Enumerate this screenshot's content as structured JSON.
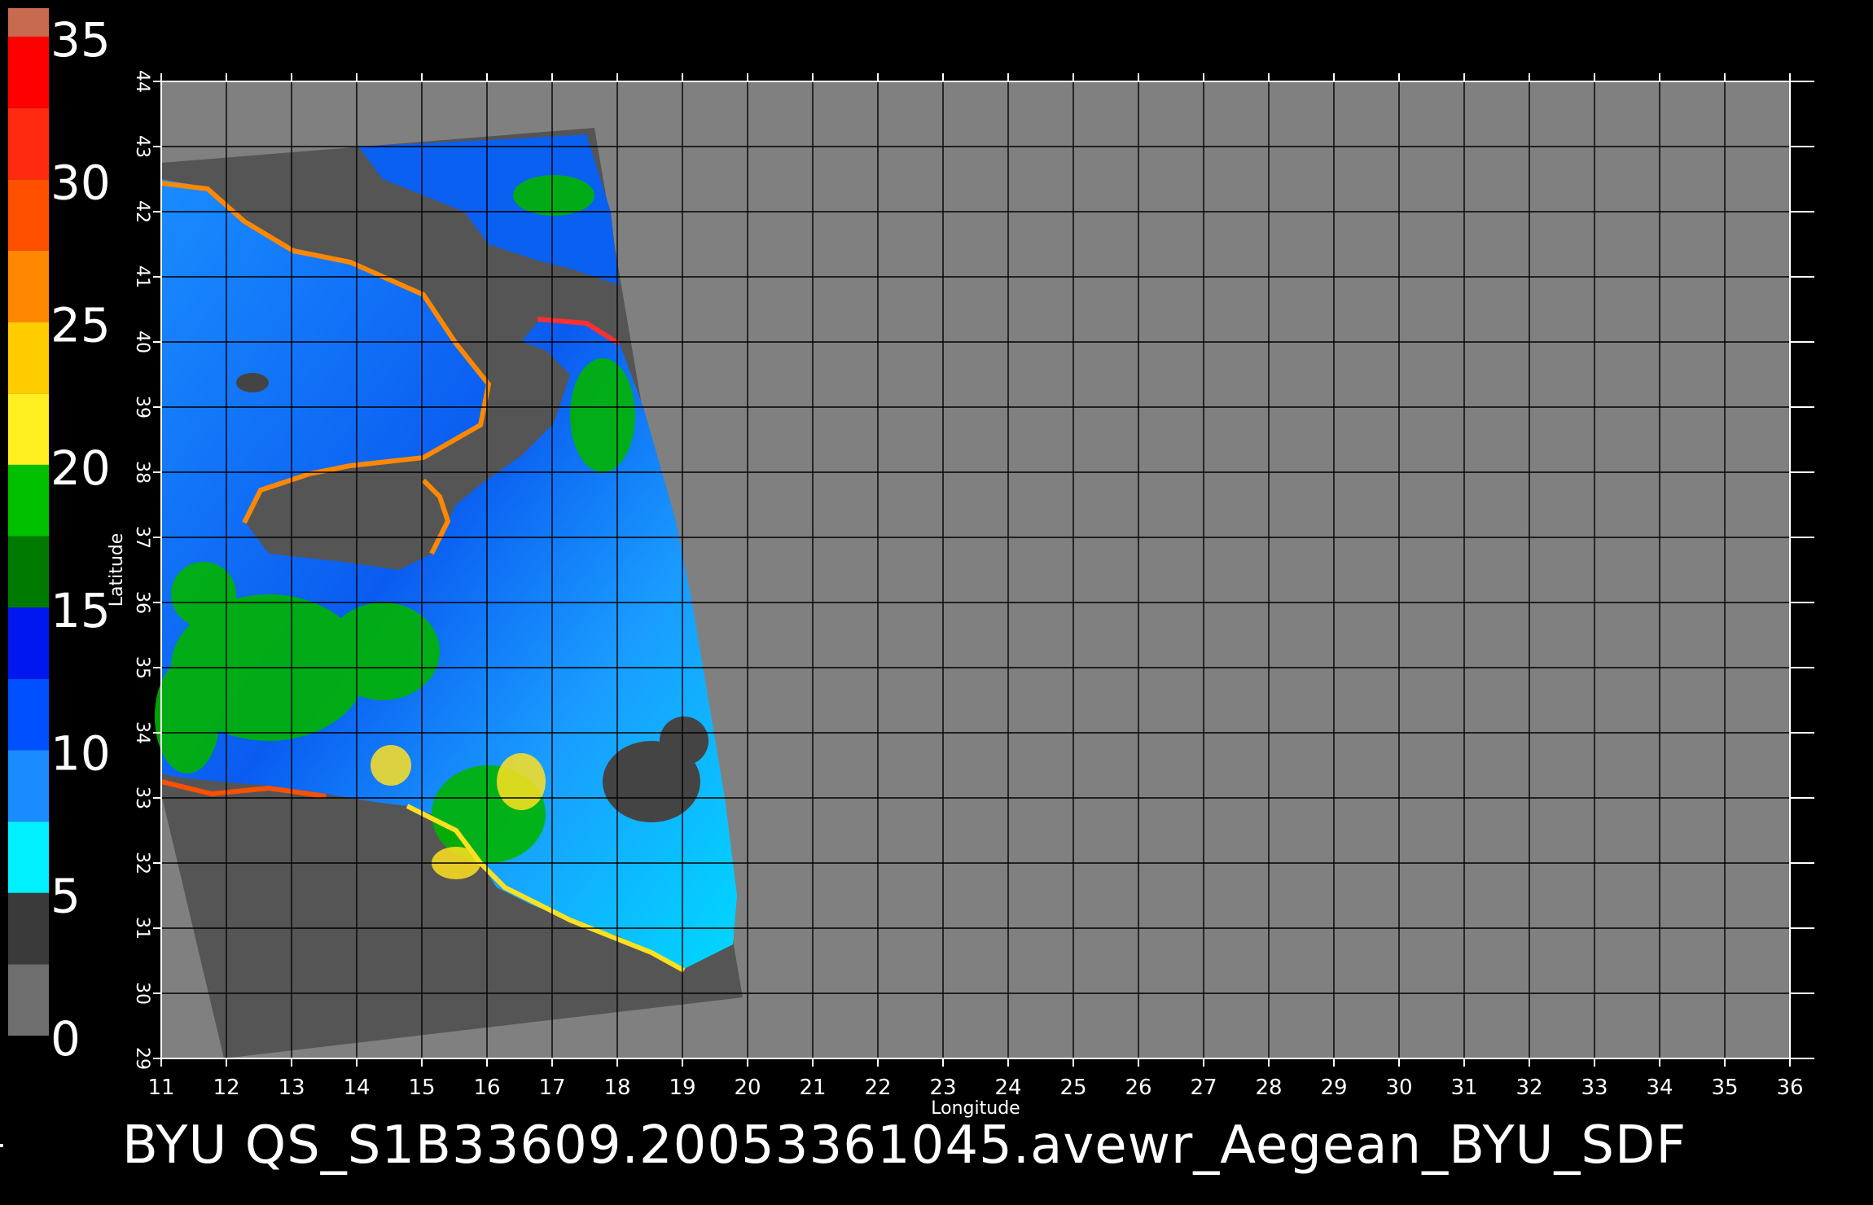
{
  "figure": {
    "title": "BYU  QS_S1B33609.20053361045.avewr_Aegean_BYU_SDF",
    "xlabel": "Longitude",
    "ylabel": "Latitude"
  },
  "colorbar": {
    "tick_labels": [
      "35",
      "30",
      "25",
      "20",
      "15",
      "10",
      "5",
      "0"
    ],
    "stops": [
      {
        "from": 0,
        "to": 2.5,
        "color": "#6e6e6e"
      },
      {
        "from": 2.5,
        "to": 5,
        "color": "#3a3a3a"
      },
      {
        "from": 5,
        "to": 7.5,
        "color": "#00f0ff"
      },
      {
        "from": 7.5,
        "to": 10,
        "color": "#1a8cff"
      },
      {
        "from": 10,
        "to": 12.5,
        "color": "#0050ff"
      },
      {
        "from": 12.5,
        "to": 15,
        "color": "#0018f0"
      },
      {
        "from": 15,
        "to": 17.5,
        "color": "#007a00"
      },
      {
        "from": 17.5,
        "to": 20,
        "color": "#00c000"
      },
      {
        "from": 20,
        "to": 22.5,
        "color": "#ffee20"
      },
      {
        "from": 22.5,
        "to": 25,
        "color": "#ffcc00"
      },
      {
        "from": 25,
        "to": 27.5,
        "color": "#ff8800"
      },
      {
        "from": 27.5,
        "to": 30,
        "color": "#ff5000"
      },
      {
        "from": 30,
        "to": 32.5,
        "color": "#ff2a10"
      },
      {
        "from": 32.5,
        "to": 35,
        "color": "#ff0000"
      },
      {
        "from": 35,
        "to": 36,
        "color": "#c86a50"
      }
    ]
  },
  "map": {
    "xlim": [
      11,
      36
    ],
    "ylim": [
      29,
      44
    ],
    "x_ticks": [
      "11",
      "12",
      "13",
      "14",
      "15",
      "16",
      "17",
      "18",
      "19",
      "20",
      "21",
      "22",
      "23",
      "24",
      "25",
      "26",
      "27",
      "28",
      "29",
      "30",
      "31",
      "32",
      "33",
      "34",
      "35",
      "36"
    ],
    "y_ticks": [
      "29",
      "30",
      "31",
      "32",
      "33",
      "34",
      "35",
      "36",
      "37",
      "38",
      "39",
      "40",
      "41",
      "42",
      "43",
      "44"
    ],
    "background_color": "#808080",
    "land_color": "#555555",
    "grid": true
  }
}
